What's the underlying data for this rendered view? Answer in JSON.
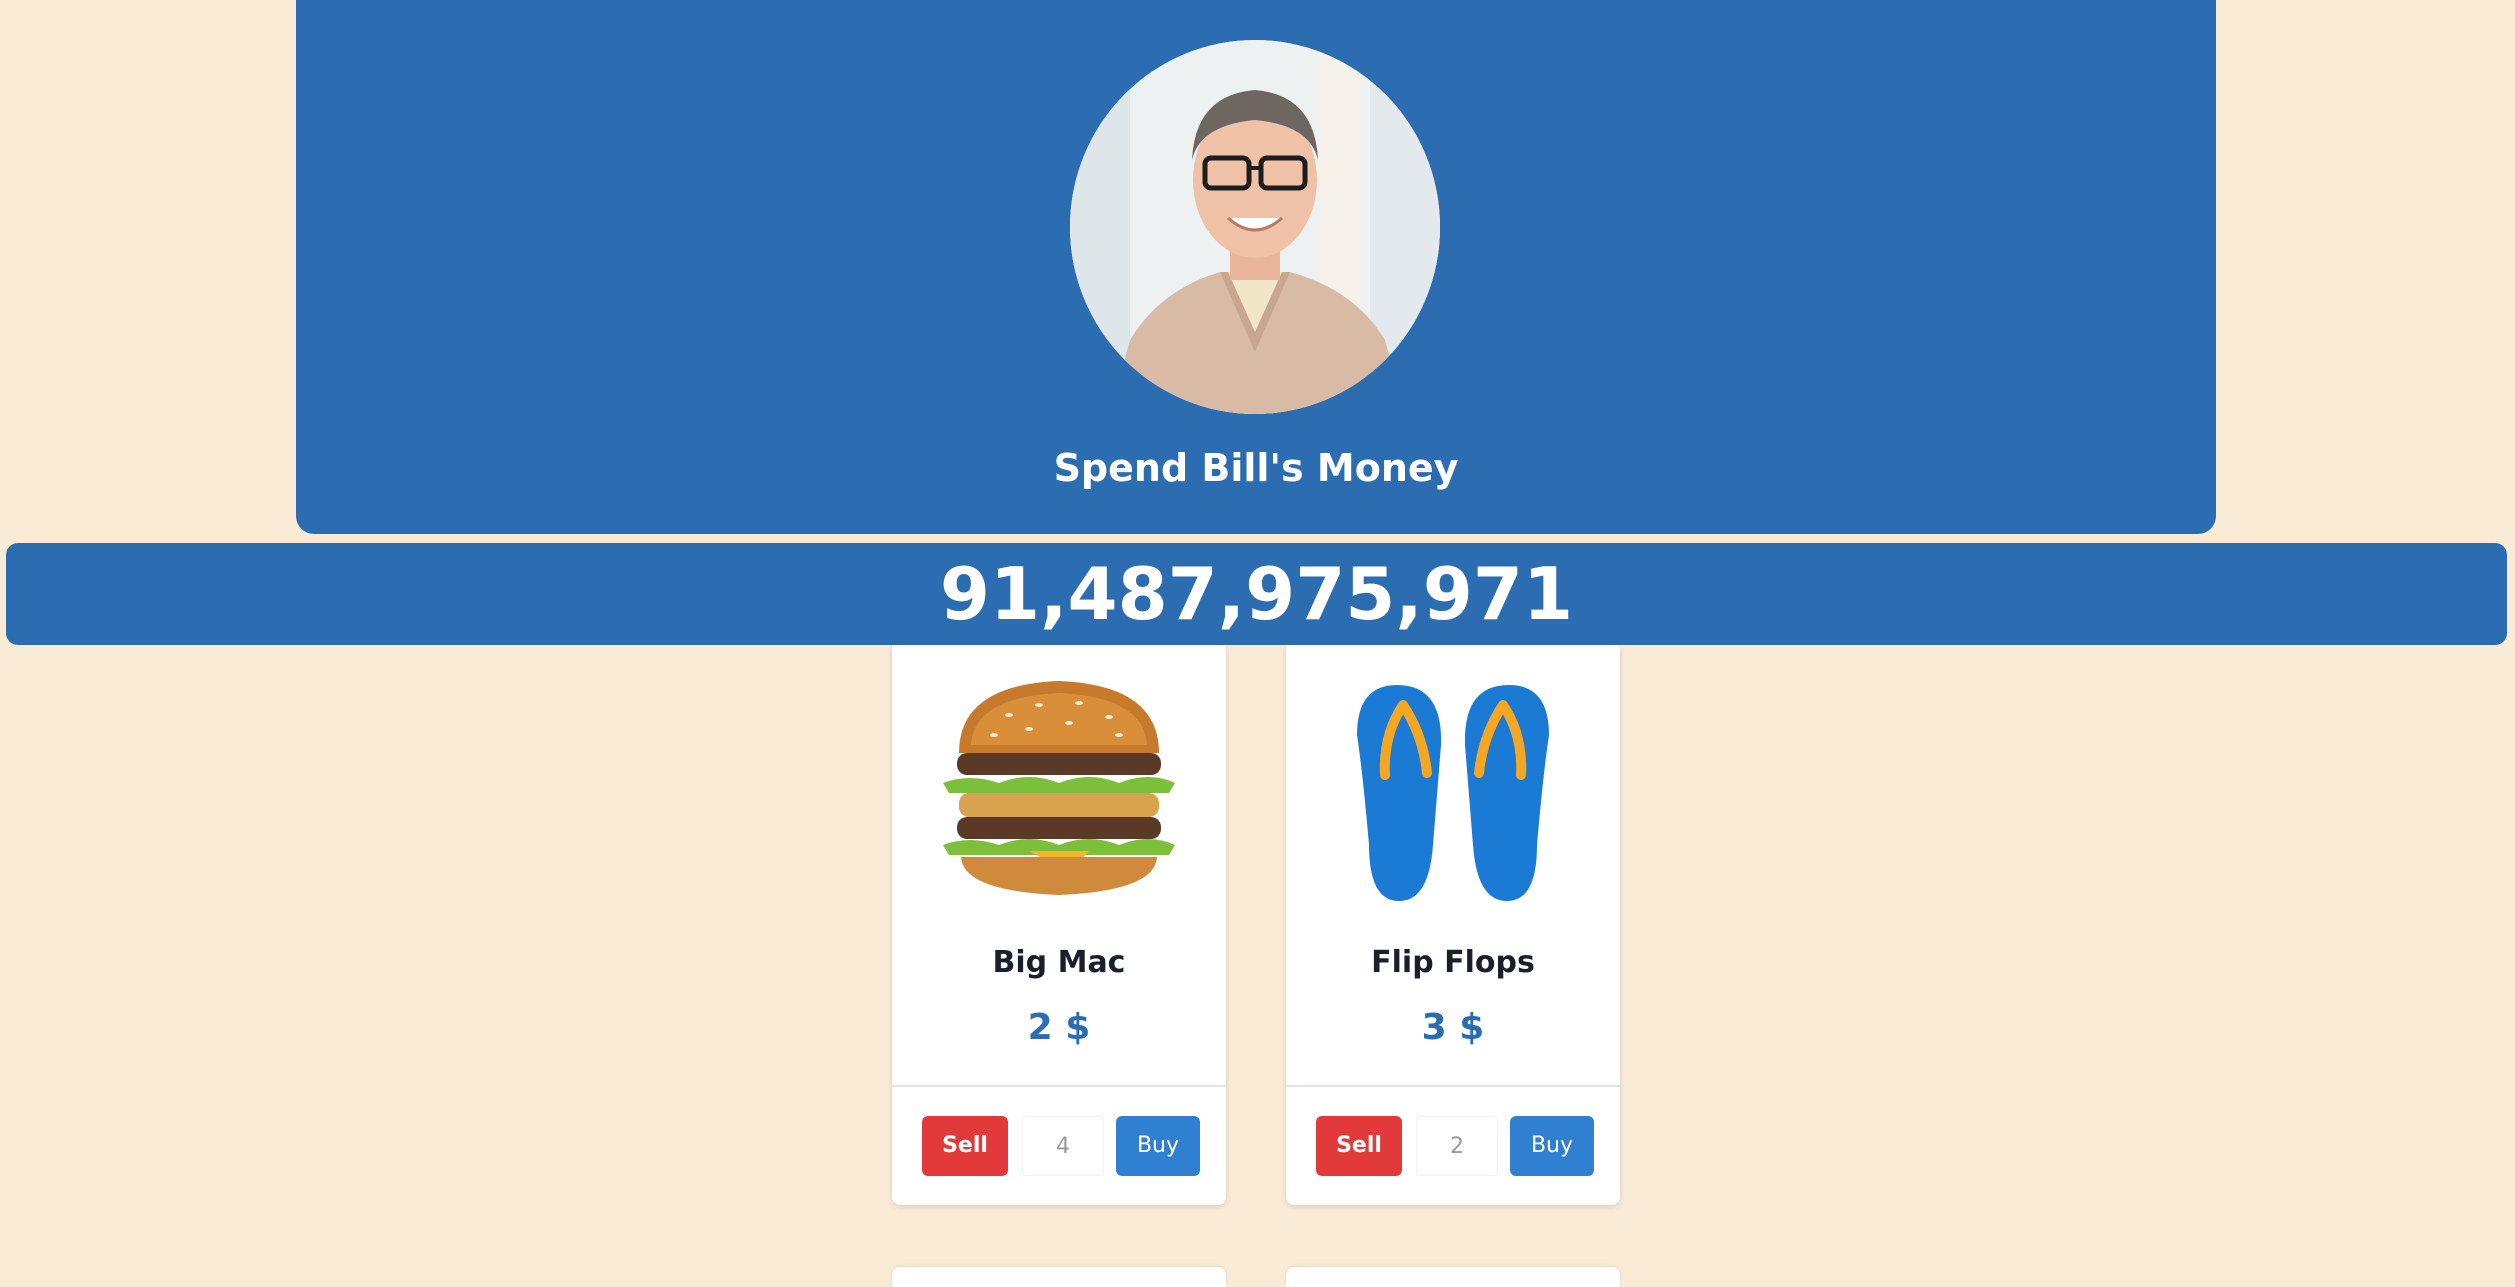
{
  "header": {
    "title": "Spend Bill's Money",
    "avatar_alt": "Bill Gates"
  },
  "balance": {
    "amount": "91,487,975,971"
  },
  "products": [
    {
      "name": "Big Mac",
      "price": "2 $",
      "quantity": "4",
      "image_icon": "burger-image",
      "sell_label": "Sell",
      "buy_label": "Buy"
    },
    {
      "name": "Flip Flops",
      "price": "3 $",
      "quantity": "2",
      "image_icon": "flip-flops-image",
      "sell_label": "Sell",
      "buy_label": "Buy"
    }
  ],
  "colors": {
    "page_background": "#faebd7",
    "brand_blue": "#2c6cb1",
    "sell_red": "#e23a3a",
    "buy_blue": "#2f80d0"
  }
}
